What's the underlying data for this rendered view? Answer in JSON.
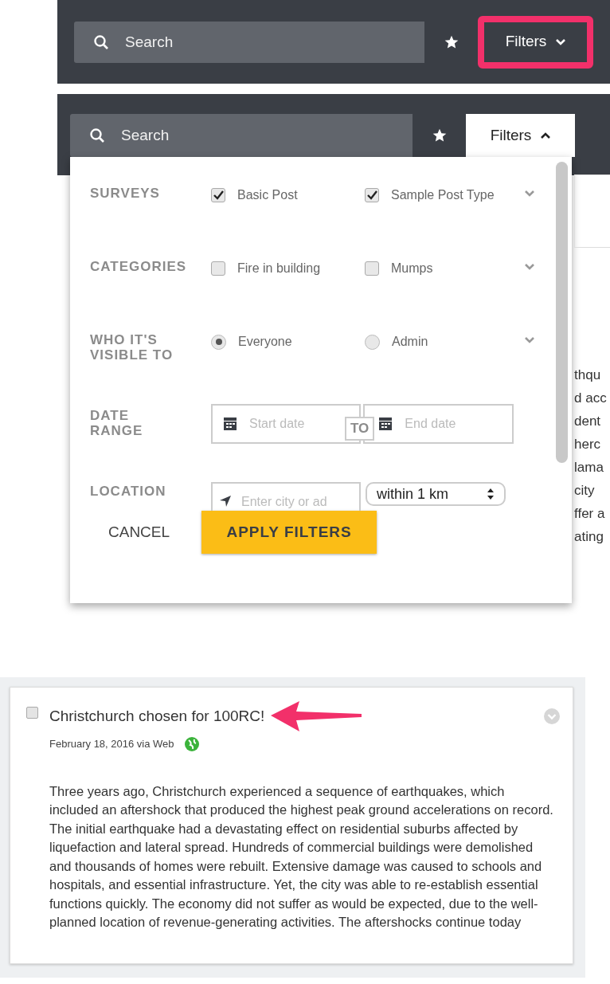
{
  "top_bar": {
    "search": {
      "placeholder": "Search"
    },
    "filters_button": {
      "label": "Filters",
      "expanded": false,
      "highlighted": true
    }
  },
  "filter_panel": {
    "search": {
      "placeholder": "Search"
    },
    "filters_button": {
      "label": "Filters",
      "expanded": true,
      "highlighted": false
    },
    "sections": [
      {
        "kind": "checkbox",
        "label": "SURVEYS",
        "options": [
          {
            "label": "Basic Post",
            "checked": true
          },
          {
            "label": "Sample Post Type",
            "checked": true
          }
        ]
      },
      {
        "kind": "checkbox",
        "label": "CATEGORIES",
        "options": [
          {
            "label": "Fire in building",
            "checked": false
          },
          {
            "label": "Mumps",
            "checked": false
          }
        ]
      },
      {
        "kind": "radio",
        "label": "WHO IT'S VISIBLE TO",
        "options": [
          {
            "label": "Everyone",
            "selected": true
          },
          {
            "label": "Admin",
            "selected": false
          }
        ]
      }
    ],
    "date_range": {
      "label": "DATE RANGE",
      "start_placeholder": "Start date",
      "separator": "TO",
      "end_placeholder": "End date"
    },
    "location": {
      "label": "LOCATION",
      "placeholder": "Enter city or ad",
      "radius": "within 1 km"
    },
    "cancel": "CANCEL",
    "apply": "APPLY FILTERS"
  },
  "background_fragments": [
    "thqu",
    "d acc",
    "dent",
    "herc",
    "lama",
    "city",
    "ffer a",
    "ating"
  ],
  "post": {
    "checked": false,
    "title": "Christchurch chosen for 100RC!",
    "meta": "February 18, 2016 via Web",
    "body": "Three years ago, Christchurch experienced a sequence of earthquakes, which included an aftershock that produced the highest peak ground accelerations on record. The initial earthquake had a devastating effect on residential suburbs affected by liquefaction and lateral spread. Hundreds of commercial buildings were demolished and thousands of homes were rebuilt. Extensive damage was caused to schools and hospitals, and essential infrastructure. Yet, the city was able to re-establish essential functions quickly. The economy did not suffer as would be expected, due to the well-planned location of revenue-generating activities. The aftershocks continue today"
  }
}
